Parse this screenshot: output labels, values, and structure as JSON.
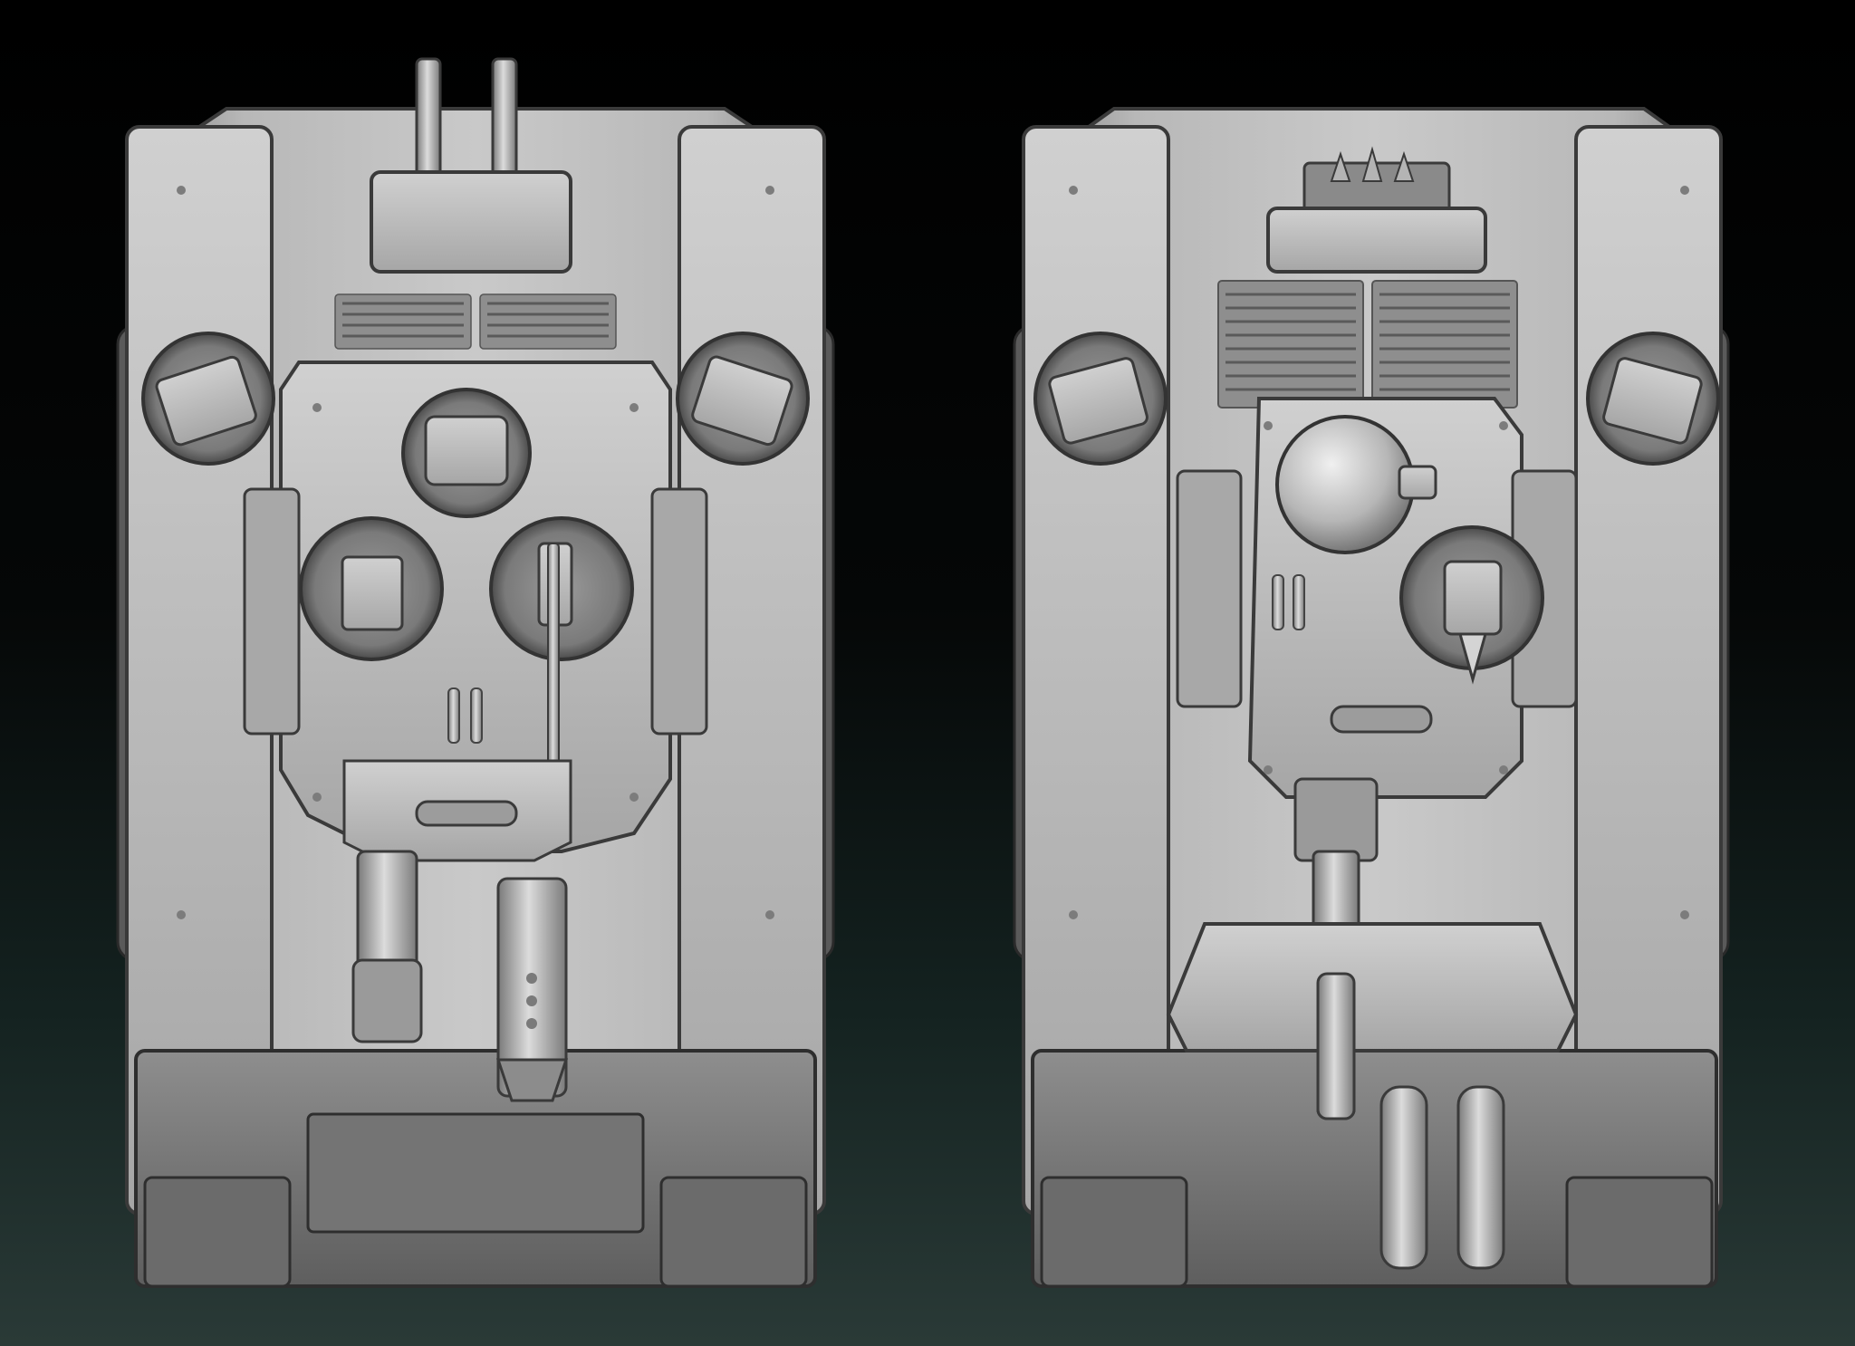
{
  "scene": {
    "kind": "3D sculpt render, top-down view",
    "subjects": [
      {
        "name": "tank-left",
        "variant": "twin-barrel top launcher, front turret with rotary cannon and heavy gun"
      },
      {
        "name": "tank-right",
        "variant": "spiked ram mount, dome hatch turret with long barrel and twin rear exhausts"
      }
    ],
    "colors": {
      "bg_top": "#000000",
      "bg_bottom": "#2a3a37",
      "metal_light": "#c8c8c8",
      "metal_mid": "#a3a3a3",
      "metal_dark": "#6e6e6e",
      "shadow": "#3c3c3c"
    }
  }
}
